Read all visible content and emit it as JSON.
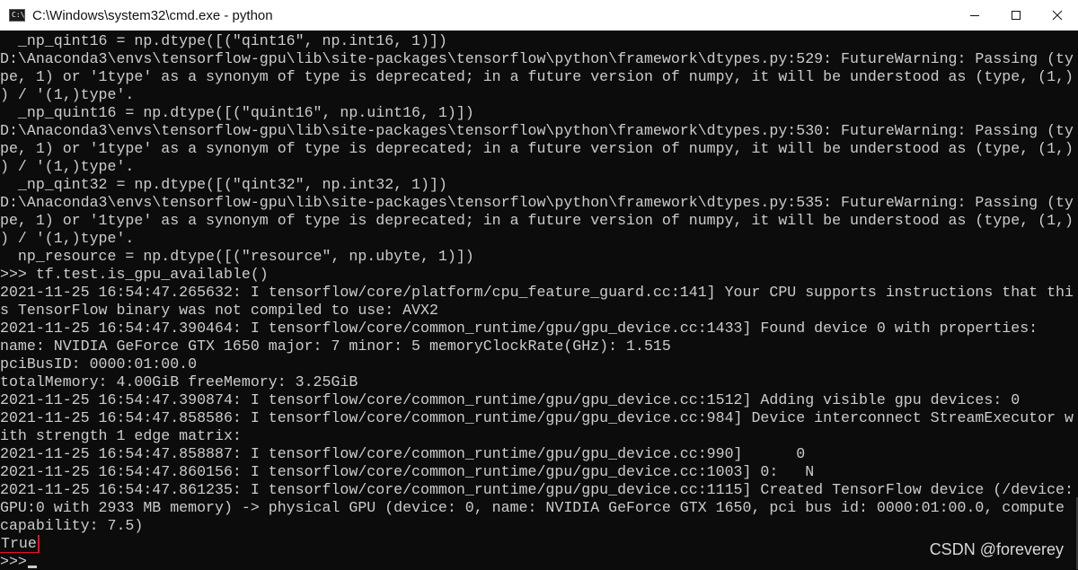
{
  "window": {
    "title": "C:\\Windows\\system32\\cmd.exe - python",
    "icon": "console-icon",
    "icon_glyph": "C:\\",
    "controls": {
      "minimize_icon": "minimize-icon",
      "maximize_icon": "maximize-icon",
      "close_icon": "close-icon"
    }
  },
  "console": {
    "lines": [
      "  _np_qint16 = np.dtype([(\"qint16\", np.int16, 1)])",
      "D:\\Anaconda3\\envs\\tensorflow-gpu\\lib\\site-packages\\tensorflow\\python\\framework\\dtypes.py:529: FutureWarning: Passing (ty",
      "pe, 1) or '1type' as a synonym of type is deprecated; in a future version of numpy, it will be understood as (type, (1,)",
      ") / '(1,)type'.",
      "  _np_quint16 = np.dtype([(\"quint16\", np.uint16, 1)])",
      "D:\\Anaconda3\\envs\\tensorflow-gpu\\lib\\site-packages\\tensorflow\\python\\framework\\dtypes.py:530: FutureWarning: Passing (ty",
      "pe, 1) or '1type' as a synonym of type is deprecated; in a future version of numpy, it will be understood as (type, (1,)",
      ") / '(1,)type'.",
      "  _np_qint32 = np.dtype([(\"qint32\", np.int32, 1)])",
      "D:\\Anaconda3\\envs\\tensorflow-gpu\\lib\\site-packages\\tensorflow\\python\\framework\\dtypes.py:535: FutureWarning: Passing (ty",
      "pe, 1) or '1type' as a synonym of type is deprecated; in a future version of numpy, it will be understood as (type, (1,)",
      ") / '(1,)type'.",
      "  np_resource = np.dtype([(\"resource\", np.ubyte, 1)])",
      ">>> tf.test.is_gpu_available()",
      "2021-11-25 16:54:47.265632: I tensorflow/core/platform/cpu_feature_guard.cc:141] Your CPU supports instructions that thi",
      "s TensorFlow binary was not compiled to use: AVX2",
      "2021-11-25 16:54:47.390464: I tensorflow/core/common_runtime/gpu/gpu_device.cc:1433] Found device 0 with properties:",
      "name: NVIDIA GeForce GTX 1650 major: 7 minor: 5 memoryClockRate(GHz): 1.515",
      "pciBusID: 0000:01:00.0",
      "totalMemory: 4.00GiB freeMemory: 3.25GiB",
      "2021-11-25 16:54:47.390874: I tensorflow/core/common_runtime/gpu/gpu_device.cc:1512] Adding visible gpu devices: 0",
      "2021-11-25 16:54:47.858586: I tensorflow/core/common_runtime/gpu/gpu_device.cc:984] Device interconnect StreamExecutor w",
      "ith strength 1 edge matrix:",
      "2021-11-25 16:54:47.858887: I tensorflow/core/common_runtime/gpu/gpu_device.cc:990]      0",
      "2021-11-25 16:54:47.860156: I tensorflow/core/common_runtime/gpu/gpu_device.cc:1003] 0:   N",
      "2021-11-25 16:54:47.861235: I tensorflow/core/common_runtime/gpu/gpu_device.cc:1115] Created TensorFlow device (/device:",
      "GPU:0 with 2933 MB memory) -> physical GPU (device: 0, name: NVIDIA GeForce GTX 1650, pci bus id: 0000:01:00.0, compute",
      "capability: 7.5)"
    ],
    "result": "True",
    "prompt": ">>>"
  },
  "watermark": "CSDN @foreverey",
  "colors": {
    "background": "#0c0c0c",
    "text": "#cccccc",
    "titlebar": "#ffffff",
    "highlight_box": "#e81123"
  }
}
